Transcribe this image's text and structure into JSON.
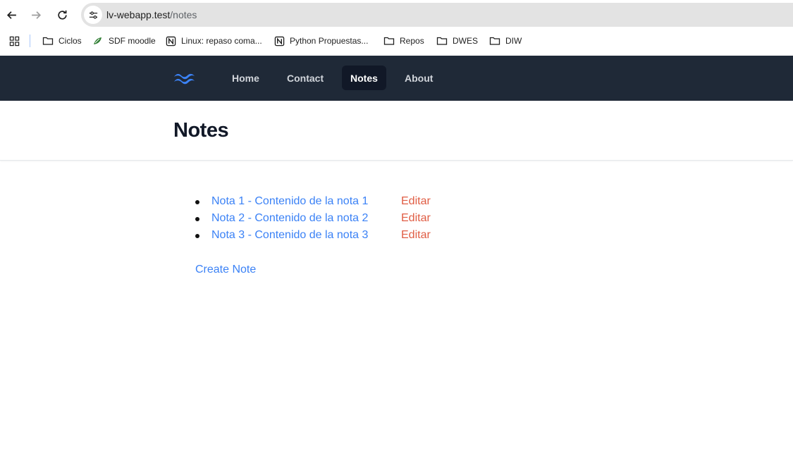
{
  "browser": {
    "url_host": "lv-webapp.test",
    "url_path": "/notes",
    "icons": {
      "back": "arrow-left-icon",
      "forward": "arrow-right-icon",
      "reload": "reload-icon",
      "site_info": "tune-icon"
    }
  },
  "bookmarks": [
    {
      "label": "Ciclos",
      "icon": "folder-icon"
    },
    {
      "label": "SDF moodle",
      "icon": "moodle-icon"
    },
    {
      "label": "Linux: repaso coma...",
      "icon": "notion-icon"
    },
    {
      "label": "Python Propuestas...",
      "icon": "notion-icon"
    },
    {
      "label": "Repos",
      "icon": "folder-icon"
    },
    {
      "label": "DWES",
      "icon": "folder-icon"
    },
    {
      "label": "DIW",
      "icon": "folder-icon"
    }
  ],
  "nav": {
    "logo_icon": "tailwind-logo-icon",
    "accent": "#3b82f6",
    "links": [
      {
        "label": "Home",
        "active": false
      },
      {
        "label": "Contact",
        "active": false
      },
      {
        "label": "Notes",
        "active": true
      },
      {
        "label": "About",
        "active": false
      }
    ]
  },
  "header": {
    "title": "Notes"
  },
  "notes": [
    {
      "label": "Nota 1 - Contenido de la nota 1",
      "edit": "Editar"
    },
    {
      "label": "Nota 2 - Contenido de la nota 2",
      "edit": "Editar"
    },
    {
      "label": "Nota 3 - Contenido de la nota 3",
      "edit": "Editar"
    }
  ],
  "create_label": "Create Note",
  "colors": {
    "nav_bg": "#1f2937",
    "active_bg": "#111827",
    "link": "#3b82f6",
    "edit": "#e05d44"
  }
}
